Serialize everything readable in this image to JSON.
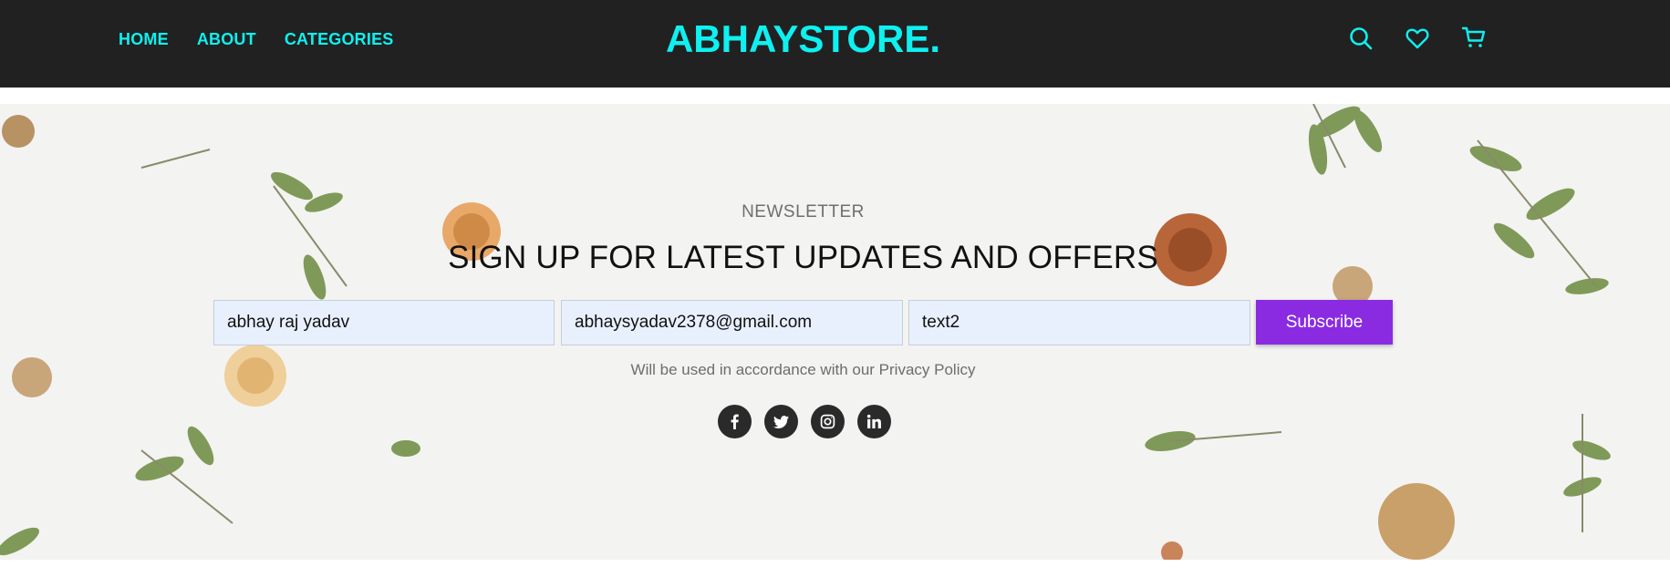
{
  "header": {
    "nav": [
      {
        "label": "HOME"
      },
      {
        "label": "ABOUT"
      },
      {
        "label": "CATEGORIES"
      }
    ],
    "logo": "ABHAYSTORE.",
    "icons": [
      "search-icon",
      "heart-icon",
      "cart-icon"
    ],
    "accent_color": "#0ff0f0",
    "background_color": "#212121"
  },
  "newsletter": {
    "eyebrow": "NEWSLETTER",
    "headline": "SIGN UP FOR LATEST UPDATES AND OFFERS",
    "fields": [
      {
        "value": "abhay raj yadav"
      },
      {
        "value": "abhaysyadav2378@gmail.com"
      },
      {
        "value": "text2"
      }
    ],
    "subscribe_label": "Subscribe",
    "subscribe_color": "#8a2be2",
    "policy_text": "Will be used in accordance with our Privacy Policy",
    "socials": [
      "facebook-icon",
      "twitter-icon",
      "instagram-icon",
      "linkedin-icon"
    ]
  }
}
